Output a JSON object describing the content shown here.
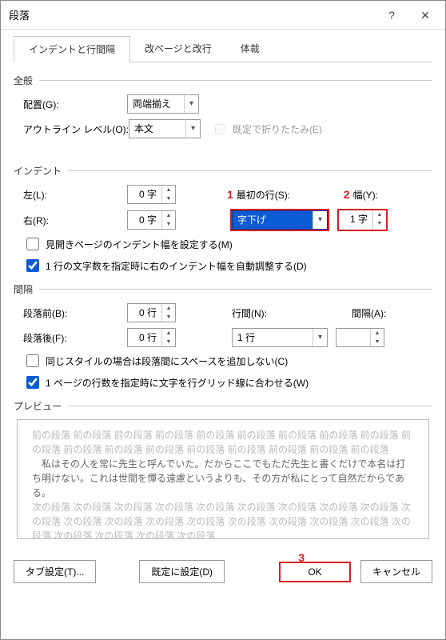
{
  "title": "段落",
  "tabs": {
    "t1": "インデントと行間隔",
    "t2": "改ページと改行",
    "t3": "体裁"
  },
  "sec": {
    "general": "全般",
    "indent": "インデント",
    "spacing": "間隔",
    "preview": "プレビュー"
  },
  "general": {
    "align_lbl": "配置(G):",
    "align_val": "両端揃え",
    "outline_lbl": "アウトライン レベル(O):",
    "outline_val": "本文",
    "collapse_lbl": "既定で折りたたみ(E)"
  },
  "indent": {
    "left_lbl": "左(L):",
    "left_val": "0 字",
    "right_lbl": "右(R):",
    "right_val": "0 字",
    "firstline_lbl": "最初の行(S):",
    "firstline_val": "字下げ",
    "width_lbl": "幅(Y):",
    "width_val": "1 字",
    "mirror_lbl": "見開きページのインデント幅を設定する(M)",
    "auto_lbl": "1 行の文字数を指定時に右のインデント幅を自動調整する(D)"
  },
  "spacing": {
    "before_lbl": "段落前(B):",
    "before_val": "0 行",
    "after_lbl": "段落後(F):",
    "after_val": "0 行",
    "line_lbl": "行間(N):",
    "line_val": "1 行",
    "at_lbl": "間隔(A):",
    "at_val": "",
    "nospace_lbl": "同じスタイルの場合は段落間にスペースを追加しない(C)",
    "grid_lbl": "1 ページの行数を指定時に文字を行グリッド線に合わせる(W)"
  },
  "preview": {
    "prev": "前の段落 前の段落 前の段落 前の段落 前の段落 前の段落 前の段落 前の段落 前の段落 前の段落 前の段落 前の段落 前の段落 前の段落 前の段落 前の段落 前の段落 前の段落",
    "sample": "　私はその人を常に先生と呼んでいた。だからここでもただ先生と書くだけで本名は打ち明けない。これは世間を憚る遠慮というよりも、その方が私にとって自然だからである。",
    "next": "次の段落 次の段落 次の段落 次の段落 次の段落 次の段落 次の段落 次の段落 次の段落 次の段落 次の段落 次の段落 次の段落 次の段落 次の段落 次の段落 次の段落 次の段落 次の段落 次の段落 次の段落 次の段落 次の段落"
  },
  "buttons": {
    "tabs": "タブ設定(T)...",
    "default": "既定に設定(D)",
    "ok": "OK",
    "cancel": "キャンセル"
  },
  "anno": {
    "n1": "1",
    "n2": "2",
    "n3": "3"
  }
}
